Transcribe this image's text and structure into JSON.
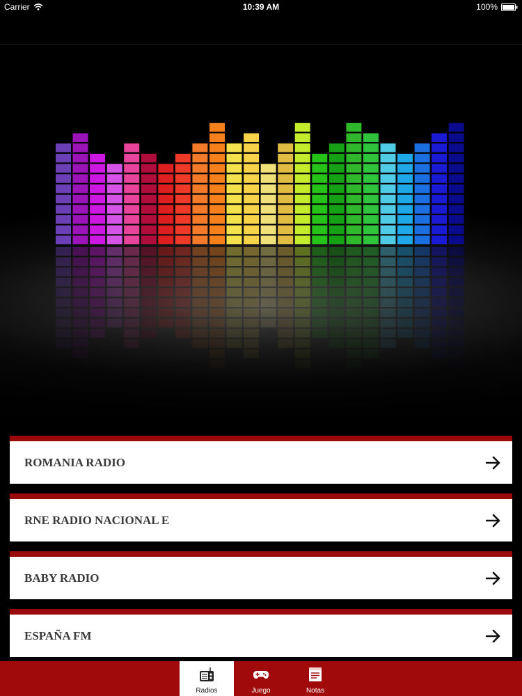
{
  "status_bar": {
    "carrier": "Carrier",
    "time": "10:39 AM",
    "battery": "100%"
  },
  "banner": {
    "image": "equalizer-graphic",
    "bars": [
      {
        "color": "#6b3fb5",
        "level": 10
      },
      {
        "color": "#9a14b8",
        "level": 11
      },
      {
        "color": "#cc18e0",
        "level": 9
      },
      {
        "color": "#d653e8",
        "level": 8
      },
      {
        "color": "#e8449b",
        "level": 10
      },
      {
        "color": "#b10d3c",
        "level": 9
      },
      {
        "color": "#de1f1f",
        "level": 8
      },
      {
        "color": "#ef3a2a",
        "level": 9
      },
      {
        "color": "#f27a2a",
        "level": 10
      },
      {
        "color": "#f5801c",
        "level": 12
      },
      {
        "color": "#f4e24c",
        "level": 10
      },
      {
        "color": "#f7d34a",
        "level": 11
      },
      {
        "color": "#efe07a",
        "level": 8
      },
      {
        "color": "#e1bc42",
        "level": 10
      },
      {
        "color": "#c4ec2c",
        "level": 12
      },
      {
        "color": "#26c21a",
        "level": 9
      },
      {
        "color": "#15a015",
        "level": 10
      },
      {
        "color": "#2fb82c",
        "level": 12
      },
      {
        "color": "#2fc43c",
        "level": 11
      },
      {
        "color": "#50cbe6",
        "level": 10
      },
      {
        "color": "#1ea8e8",
        "level": 9
      },
      {
        "color": "#1b6fe0",
        "level": 10
      },
      {
        "color": "#1a1ad4",
        "level": 11
      },
      {
        "color": "#0a0a8c",
        "level": 12
      }
    ]
  },
  "stations": [
    {
      "label": "ROMANIA RADIO",
      "icon": "arrow-right-icon"
    },
    {
      "label": "RNE RADIO NACIONAL E",
      "icon": "arrow-right-icon"
    },
    {
      "label": "BABY RADIO",
      "icon": "arrow-right-icon"
    },
    {
      "label": "ESPAÑA FM",
      "icon": "arrow-right-icon"
    }
  ],
  "tabs": [
    {
      "label": "Radios",
      "icon": "radio-icon",
      "active": true
    },
    {
      "label": "Juego",
      "icon": "gamepad-icon",
      "active": false
    },
    {
      "label": "Notas",
      "icon": "notes-icon",
      "active": false
    }
  ],
  "colors": {
    "accent": "#9b0a0a",
    "tab_bar": "#a00a0a",
    "item_background": "#ffffff"
  }
}
